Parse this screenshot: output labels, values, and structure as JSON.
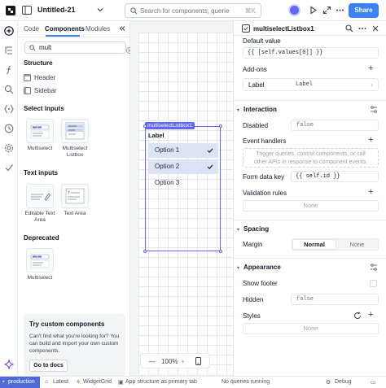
{
  "app": {
    "title": "Untitled-21"
  },
  "search": {
    "placeholder": "Search for components, queries, an...",
    "shortcut": "⌘K"
  },
  "header": {
    "share_label": "Share"
  },
  "left_panel": {
    "tabs": [
      {
        "label": "Code"
      },
      {
        "label": "Components"
      },
      {
        "label": "Modules"
      }
    ],
    "search_value": "mult",
    "structure": {
      "title": "Structure",
      "items": [
        {
          "label": "Header"
        },
        {
          "label": "Sidebar"
        }
      ]
    },
    "select_inputs": {
      "title": "Select inputs",
      "items": [
        {
          "label": "Multiselect"
        },
        {
          "label": "Multiselect Listbox"
        }
      ]
    },
    "text_inputs": {
      "title": "Text inputs",
      "items": [
        {
          "label": "Editable Text Area"
        },
        {
          "label": "Text Area"
        }
      ]
    },
    "deprecated": {
      "title": "Deprecated",
      "items": [
        {
          "label": "Multiselect"
        }
      ]
    },
    "promo": {
      "title": "Try custom components",
      "text": "Can't find what you're looking for? You can build and import your own custom components.",
      "button": "Go to docs"
    }
  },
  "canvas": {
    "component_tag": "multiselectListbox1",
    "listbox": {
      "label": "Label",
      "options": [
        {
          "label": "Option 1",
          "selected": true
        },
        {
          "label": "Option 2",
          "selected": true
        },
        {
          "label": "Option 3",
          "selected": false
        }
      ]
    },
    "zoom": "100%"
  },
  "inspector": {
    "component_name": "multiselectListbox1",
    "default_value_label": "Default value",
    "default_value_code": "{{ [self.values[0]] }}",
    "addons_label": "Add-ons",
    "addon_label_name": "Label",
    "addon_label_value": "Label",
    "interaction": {
      "title": "Interaction",
      "disabled_label": "Disabled",
      "disabled_value": "false",
      "event_handlers_label": "Event handlers",
      "event_handlers_hint": "Trigger queries, control components, or call other APIs in response to component events.",
      "form_data_key_label": "Form data key",
      "form_data_key_value": "{{ self.id }}",
      "validation_rules_label": "Validation rules",
      "validation_rules_value": "None"
    },
    "spacing": {
      "title": "Spacing",
      "margin_label": "Margin",
      "margin_options": [
        "Normal",
        "None"
      ],
      "margin_selected": "Normal"
    },
    "appearance": {
      "title": "Appearance",
      "show_footer_label": "Show footer",
      "show_footer_checked": false,
      "hidden_label": "Hidden",
      "hidden_value": "false",
      "styles_label": "Styles",
      "styles_value": "None"
    }
  },
  "status_bar": {
    "env": "production",
    "latest": "Latest",
    "widget": "WidgetGrid",
    "structure": "App structure as primary tab",
    "queries": "No queries running",
    "debug": "Debug"
  },
  "colors": {
    "accent": "#3b82f6",
    "selection": "#6366f1",
    "env": "#4f6bd8"
  }
}
